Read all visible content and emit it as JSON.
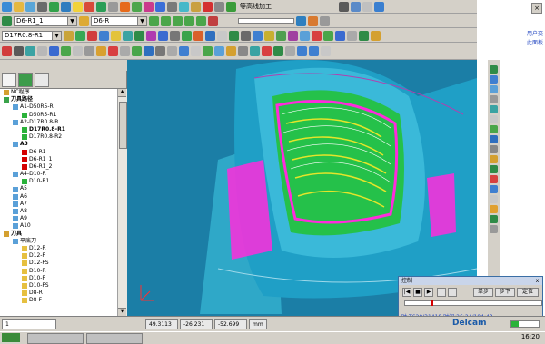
{
  "toolbar1": {
    "strategy_label": "等高线加工"
  },
  "toolbar2": {
    "toolpath_combo": "D6-R1_1",
    "tool_combo": "D6-R"
  },
  "toolbar3": {
    "boundary_combo": "D17R0.8-R1"
  },
  "right_strip": {
    "text1": "用户交",
    "text2": "此面板"
  },
  "tree": {
    "rows": [
      {
        "label": "NC程序",
        "indent": 0,
        "bold": false,
        "icon": "nc-program"
      },
      {
        "label": "刀具路径",
        "indent": 0,
        "bold": true,
        "icon": "toolpath-folder"
      },
      {
        "label": "A1-D50R5-R",
        "indent": 1,
        "bold": false,
        "icon": "folder"
      },
      {
        "label": "D50R5-R1",
        "indent": 2,
        "bold": false,
        "icon": "toolpath"
      },
      {
        "label": "A2-D17R0.8-R",
        "indent": 1,
        "bold": false,
        "icon": "folder"
      },
      {
        "label": "D17R0.8-R1",
        "indent": 2,
        "bold": true,
        "icon": "toolpath"
      },
      {
        "label": "D17R0.8-R2",
        "indent": 2,
        "bold": false,
        "icon": "toolpath"
      },
      {
        "label": "A3",
        "indent": 1,
        "bold": true,
        "icon": "folder"
      },
      {
        "label": "D6-R1",
        "indent": 2,
        "bold": false,
        "icon": "toolpath-red"
      },
      {
        "label": "D6-R1_1",
        "indent": 2,
        "bold": false,
        "icon": "toolpath-red"
      },
      {
        "label": "D6-R1_2",
        "indent": 2,
        "bold": false,
        "icon": "toolpath-red"
      },
      {
        "label": "A4-D10-R",
        "indent": 1,
        "bold": false,
        "icon": "folder"
      },
      {
        "label": "D10-R1",
        "indent": 2,
        "bold": false,
        "icon": "toolpath"
      },
      {
        "label": "A5",
        "indent": 1,
        "bold": false,
        "icon": "folder"
      },
      {
        "label": "A6",
        "indent": 1,
        "bold": false,
        "icon": "folder"
      },
      {
        "label": "A7",
        "indent": 1,
        "bold": false,
        "icon": "folder"
      },
      {
        "label": "A8",
        "indent": 1,
        "bold": false,
        "icon": "folder"
      },
      {
        "label": "A9",
        "indent": 1,
        "bold": false,
        "icon": "folder"
      },
      {
        "label": "A10",
        "indent": 1,
        "bold": false,
        "icon": "folder"
      },
      {
        "label": "刀具",
        "indent": 0,
        "bold": true,
        "icon": "tool-folder"
      },
      {
        "label": "平底刀",
        "indent": 1,
        "bold": false,
        "icon": "folder"
      },
      {
        "label": "D12-R",
        "indent": 2,
        "bold": false,
        "icon": "tool"
      },
      {
        "label": "D12-F",
        "indent": 2,
        "bold": false,
        "icon": "tool"
      },
      {
        "label": "D12-FS",
        "indent": 2,
        "bold": false,
        "icon": "tool"
      },
      {
        "label": "D10-R",
        "indent": 2,
        "bold": false,
        "icon": "tool"
      },
      {
        "label": "D10-F",
        "indent": 2,
        "bold": false,
        "icon": "tool"
      },
      {
        "label": "D10-FS",
        "indent": 2,
        "bold": false,
        "icon": "tool"
      },
      {
        "label": "D8-R",
        "indent": 2,
        "bold": false,
        "icon": "tool"
      },
      {
        "label": "D8-F",
        "indent": 2,
        "bold": false,
        "icon": "tool"
      }
    ]
  },
  "status": {
    "combo_value": "1",
    "x": "49.3113",
    "y": "-26.231",
    "z": "-52.699",
    "unit": "mm"
  },
  "dialog": {
    "title": "控制",
    "btn_single": "单步",
    "btn_next": "步下",
    "btn_stop": "定位",
    "time_text": "时:T620/31418 时间:26:24/104:43",
    "close": "x"
  },
  "taskbar": {
    "clock": "16:20"
  },
  "brand": "Delcam",
  "colors": {
    "viewport_bg": "#1b7ea6",
    "part_cyan": "#29b8d8",
    "toolpath_green": "#35e53a",
    "toolpath_magenta": "#ff2bdc",
    "toolpath_yellow": "#e5e52a"
  }
}
